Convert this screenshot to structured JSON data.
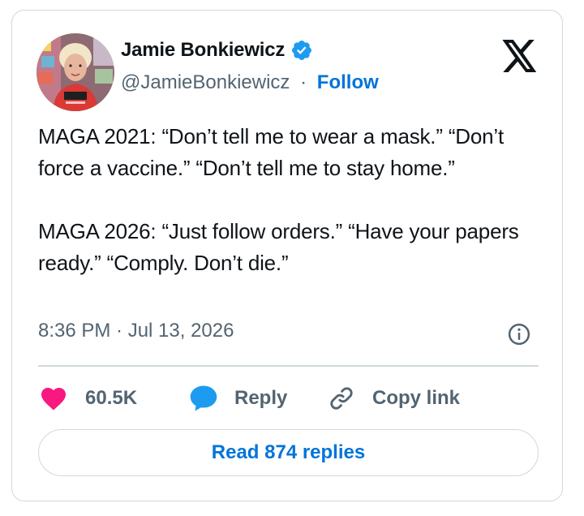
{
  "author": {
    "name": "Jamie Bonkiewicz",
    "handle": "@JamieBonkiewicz",
    "separator": "·",
    "follow_label": "Follow",
    "verified": true
  },
  "tweet": {
    "text": "MAGA 2021: “Don’t tell me to wear a mask.” “Don’t force a vaccine.” “Don’t tell me to stay home.”\n\nMAGA 2026: “Just follow orders.” “Have your papers ready.” “Comply. Don’t die.”",
    "timestamp": "8:36 PM · Jul 13, 2026"
  },
  "actions": {
    "like_count": "60.5K",
    "reply_label": "Reply",
    "copy_label": "Copy link"
  },
  "read_replies_label": "Read 874 replies",
  "icons": {
    "verified": "verified-badge-icon",
    "brand": "x-logo-icon",
    "info": "info-icon",
    "like": "heart-icon",
    "reply": "speech-bubble-icon",
    "copy": "link-icon"
  },
  "colors": {
    "accent": "#0074d9",
    "verified": "#1d9bf0",
    "like": "#f91880",
    "muted": "#536471",
    "border": "#cfd9de"
  }
}
